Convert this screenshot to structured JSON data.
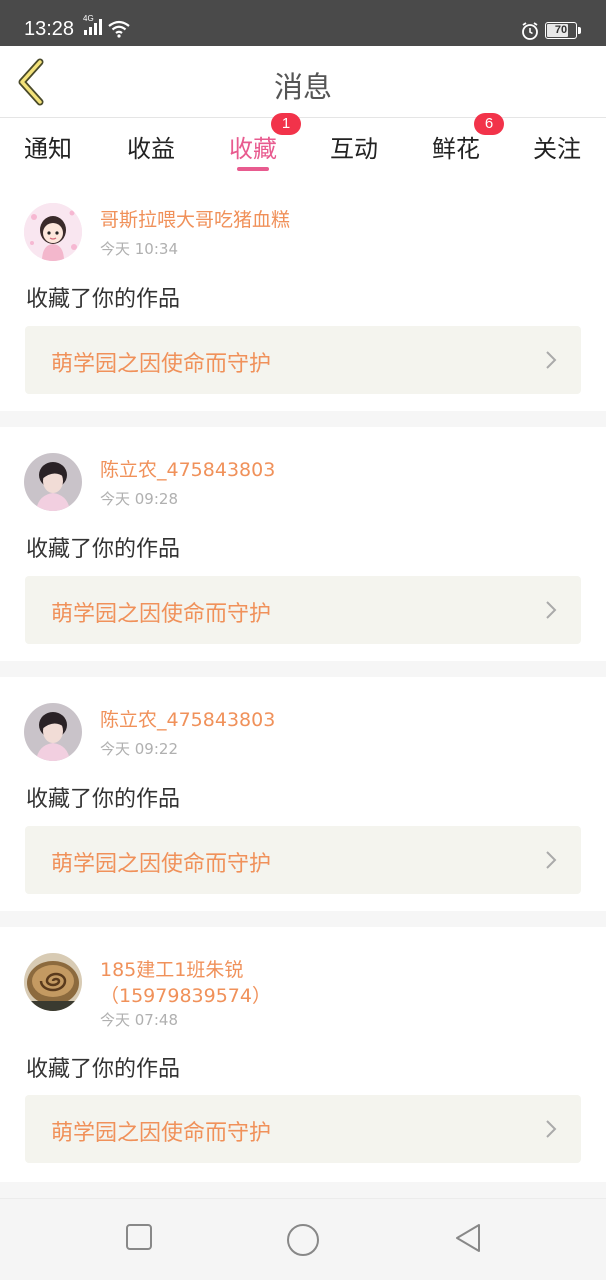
{
  "status_bar": {
    "time": "13:28",
    "network": "4G",
    "battery": "70",
    "battery_level": 0.7
  },
  "header": {
    "title": "消息",
    "back_icon": "chevron-left-icon"
  },
  "tabs": [
    {
      "label": "通知",
      "active": false
    },
    {
      "label": "收益",
      "active": false
    },
    {
      "label": "收藏",
      "active": true,
      "badge": "1"
    },
    {
      "label": "互动",
      "active": false
    },
    {
      "label": "鲜花",
      "active": false,
      "badge": "6"
    },
    {
      "label": "关注",
      "active": false
    }
  ],
  "colors": {
    "accent": "#e85b8f",
    "username": "#f0915a",
    "badge": "#f2334a"
  },
  "messages": [
    {
      "username": "哥斯拉喂大哥吃猪血糕",
      "time": "今天 10:34",
      "action": "收藏了你的作品",
      "work_title": "萌学园之因使命而守护"
    },
    {
      "username": "陈立农_475843803",
      "time": "今天 09:28",
      "action": "收藏了你的作品",
      "work_title": "萌学园之因使命而守护"
    },
    {
      "username": "陈立农_475843803",
      "time": "今天 09:22",
      "action": "收藏了你的作品",
      "work_title": "萌学园之因使命而守护"
    },
    {
      "username_line1": "185建工1班朱锐",
      "username_line2": "（15979839574）",
      "time": "今天 07:48",
      "action": "收藏了你的作品",
      "work_title": "萌学园之因使命而守护"
    }
  ],
  "nav_bar": {
    "icons": [
      "square-icon",
      "circle-icon",
      "triangle-back-icon"
    ]
  }
}
